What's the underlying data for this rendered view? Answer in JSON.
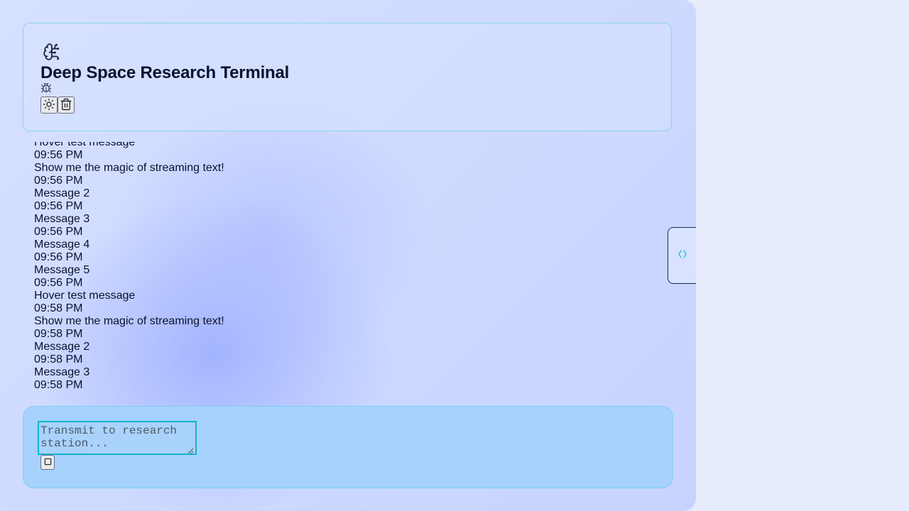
{
  "header": {
    "title": "Deep Space Research Terminal",
    "logo_icon": "brain-circuit-icon",
    "debug_icon": "bug-icon",
    "buttons": [
      {
        "icon": "sun-icon"
      },
      {
        "icon": "trash-icon"
      }
    ]
  },
  "messages": [
    {
      "text": "Hover test message",
      "time": "09:56 PM"
    },
    {
      "text": "Show me the magic of streaming text!",
      "time": "09:56 PM"
    },
    {
      "text": "Message 2",
      "time": "09:56 PM"
    },
    {
      "text": "Message 3",
      "time": "09:56 PM"
    },
    {
      "text": "Message 4",
      "time": "09:56 PM"
    },
    {
      "text": "Message 5",
      "time": "09:56 PM"
    },
    {
      "text": "Hover test message",
      "time": "09:58 PM"
    },
    {
      "text": "Show me the magic of streaming text!",
      "time": "09:58 PM"
    },
    {
      "text": "Message 2",
      "time": "09:58 PM"
    },
    {
      "text": "Message 3",
      "time": "09:58 PM"
    }
  ],
  "composer": {
    "placeholder": "Transmit to research station...",
    "send_icon": "square-icon"
  },
  "side_panel": {
    "toggle_icon": "code-brackets-icon"
  },
  "colors": {
    "accent": "#13b5cf",
    "composer_bg": "#a6d2fd",
    "text": "#0b1230"
  }
}
